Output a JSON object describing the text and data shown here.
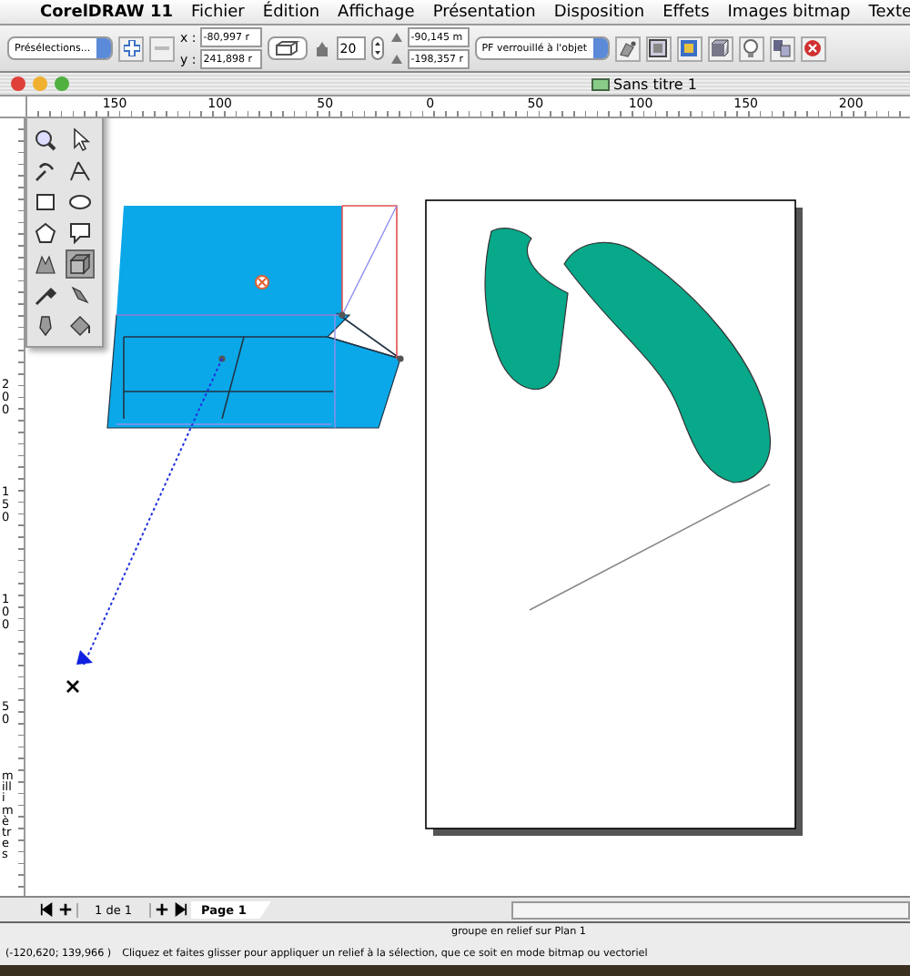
{
  "menubar": {
    "app_name": "CorelDRAW 11",
    "items": [
      "Fichier",
      "Édition",
      "Affichage",
      "Présentation",
      "Disposition",
      "Effets",
      "Images bitmap",
      "Texte"
    ]
  },
  "property_bar": {
    "presets": "Présélections...",
    "x_label": "x :",
    "x_value": "-80,997 r",
    "y_label": "y :",
    "y_value": "241,898 r",
    "depth": "20",
    "vanish_x": "-90,145 m",
    "vanish_y": "-198,357 r",
    "vanish_lock": "PF verrouillé à l'objet"
  },
  "window": {
    "title": "Sans titre 1"
  },
  "rulers": {
    "horizontal": [
      "150",
      "100",
      "50",
      "0",
      "50",
      "100",
      "150",
      "200"
    ],
    "vertical": [
      "200",
      "150",
      "100",
      "50"
    ],
    "unit": "millimètres"
  },
  "toolbox": [
    {
      "kind": "zoom",
      "selected": false
    },
    {
      "kind": "pick",
      "selected": false
    },
    {
      "kind": "freehand",
      "selected": false
    },
    {
      "kind": "shape",
      "selected": false
    },
    {
      "kind": "rectangle",
      "selected": false
    },
    {
      "kind": "ellipse",
      "selected": false
    },
    {
      "kind": "polygon",
      "selected": false
    },
    {
      "kind": "callout",
      "selected": false
    },
    {
      "kind": "blend",
      "selected": false
    },
    {
      "kind": "extrude",
      "selected": true
    },
    {
      "kind": "eyedropper",
      "selected": false
    },
    {
      "kind": "pen",
      "selected": false
    },
    {
      "kind": "outline",
      "selected": false
    },
    {
      "kind": "fill",
      "selected": false
    }
  ],
  "page_nav": {
    "counter": "1 de 1",
    "tabs": [
      {
        "label": "Page 1",
        "selected": true
      }
    ]
  },
  "status_bar": {
    "selection": "groupe en relief sur Plan 1",
    "coordinates": "(-120,620; 139,966 )",
    "hint": "Cliquez et faites glisser pour appliquer un relief à la sélection, que ce soit en mode bitmap ou vectoriel"
  }
}
